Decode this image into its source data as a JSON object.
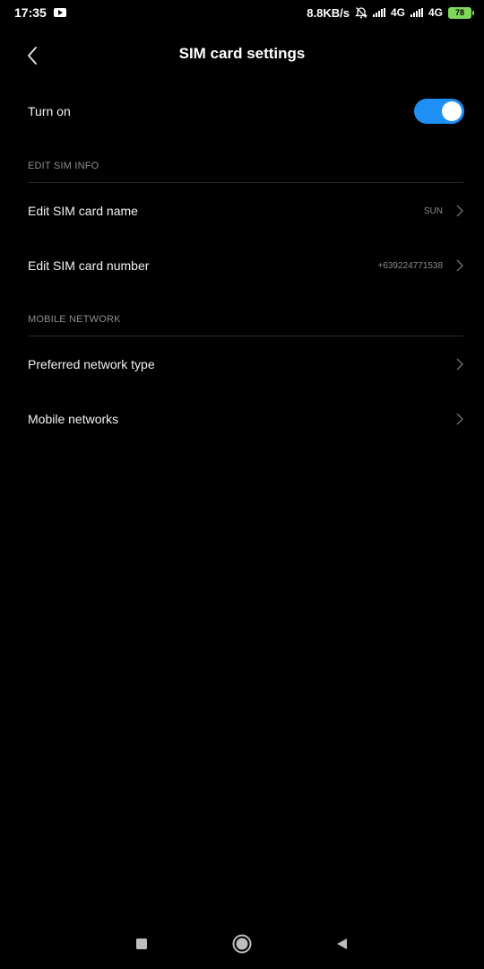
{
  "status_bar": {
    "time": "17:35",
    "net_speed": "8.8KB/s",
    "sim1_network": "4G",
    "sim2_network": "4G",
    "battery_level": "78",
    "battery_color": "#7fd85a"
  },
  "header": {
    "title": "SIM card settings"
  },
  "turn_on": {
    "label": "Turn on",
    "enabled": true,
    "accent_color": "#1e8ff5"
  },
  "sections": {
    "edit_sim_info": {
      "title": "EDIT SIM INFO",
      "items": [
        {
          "label": "Edit SIM card name",
          "value": "SUN"
        },
        {
          "label": "Edit SIM card number",
          "value": "+639224771538"
        }
      ]
    },
    "mobile_network": {
      "title": "MOBILE NETWORK",
      "items": [
        {
          "label": "Preferred network type"
        },
        {
          "label": "Mobile networks"
        }
      ]
    }
  },
  "nav_bar": {
    "recent_icon": "square-icon",
    "home_icon": "circle-icon",
    "back_icon": "triangle-back-icon"
  }
}
